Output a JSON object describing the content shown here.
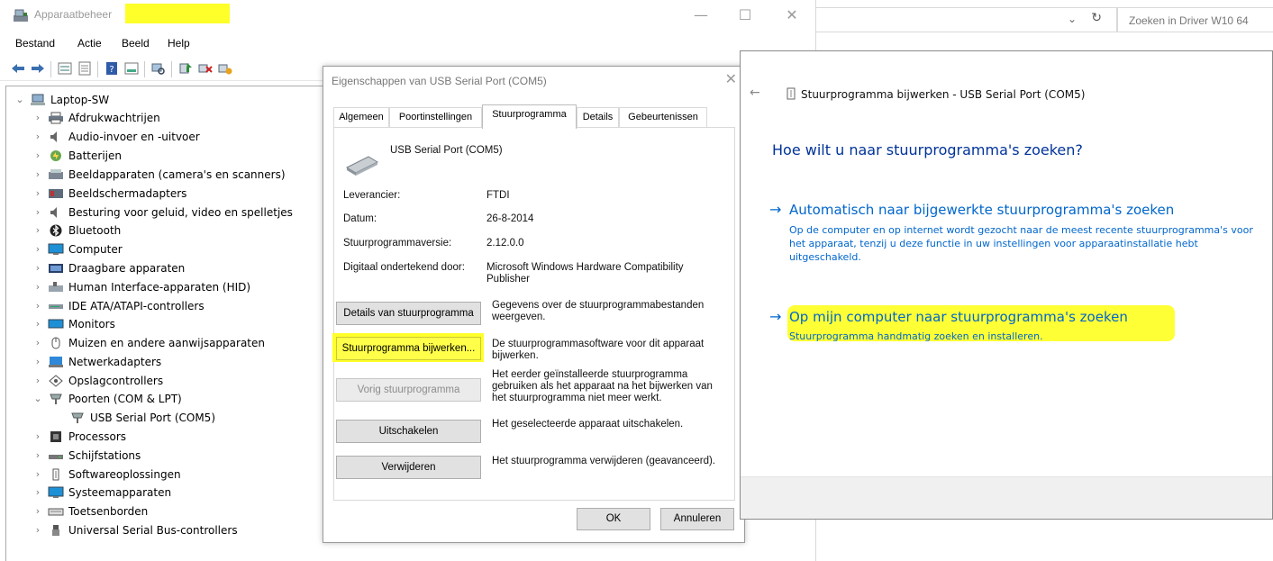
{
  "devmgr": {
    "title": "Apparaatbeheer",
    "window_buttons": {
      "minimize": "—",
      "maximize": "☐",
      "close": "✕"
    },
    "menu": [
      "Bestand",
      "Actie",
      "Beeld",
      "Help"
    ],
    "tree": {
      "root": "Laptop-SW",
      "items": [
        "Afdrukwachtrijen",
        "Audio-invoer en -uitvoer",
        "Batterijen",
        "Beeldapparaten (camera's en scanners)",
        "Beeldschermadapters",
        "Besturing voor geluid, video en spelletjes",
        "Bluetooth",
        "Computer",
        "Draagbare apparaten",
        "Human Interface-apparaten (HID)",
        "IDE ATA/ATAPI-controllers",
        "Monitors",
        "Muizen en andere aanwijsapparaten",
        "Netwerkadapters",
        "Opslagcontrollers",
        "Poorten (COM & LPT)",
        "USB Serial Port (COM5)",
        "Processors",
        "Schijfstations",
        "Softwareoplossingen",
        "Systeemapparaten",
        "Toetsenborden",
        "Universal Serial Bus-controllers"
      ]
    }
  },
  "props": {
    "title": "Eigenschappen van USB Serial Port (COM5)",
    "close": "✕",
    "tabs": [
      "Algemeen",
      "Poortinstellingen",
      "Stuurprogramma",
      "Details",
      "Gebeurtenissen"
    ],
    "device_name": "USB Serial Port (COM5)",
    "fields": {
      "provider_label": "Leverancier:",
      "provider_value": "FTDI",
      "date_label": "Datum:",
      "date_value": "26-8-2014",
      "version_label": "Stuurprogrammaversie:",
      "version_value": "2.12.0.0",
      "signer_label": "Digitaal ondertekend door:",
      "signer_value": "Microsoft Windows Hardware Compatibility Publisher"
    },
    "actions": {
      "details_btn": "Details van stuurprogramma",
      "details_desc": "Gegevens over de stuurprogrammabestanden weergeven.",
      "update_btn": "Stuurprogramma bijwerken...",
      "update_desc": "De stuurprogrammasoftware voor dit apparaat bijwerken.",
      "rollback_btn": "Vorig stuurprogramma",
      "rollback_desc": "Het eerder geïnstalleerde stuurprogramma gebruiken als het apparaat na het bijwerken van het stuurprogramma niet meer werkt.",
      "disable_btn": "Uitschakelen",
      "disable_desc": "Het geselecteerde apparaat uitschakelen.",
      "uninstall_btn": "Verwijderen",
      "uninstall_desc": "Het stuurprogramma verwijderen (geavanceerd)."
    },
    "ok": "OK",
    "cancel": "Annuleren"
  },
  "explorer": {
    "search_placeholder": "Zoeken in Driver W10 64"
  },
  "wizard": {
    "back": "←",
    "title": "Stuurprogramma bijwerken - USB Serial Port (COM5)",
    "heading": "Hoe wilt u naar stuurprogramma's zoeken?",
    "option_auto_title": "Automatisch naar bijgewerkte stuurprogramma's zoeken",
    "option_auto_desc": "Op de computer en op internet wordt gezocht naar de meest recente stuurprogramma's voor het apparaat, tenzij u deze functie in uw instellingen voor apparaatinstallatie hebt uitgeschakeld.",
    "option_manual_title": "Op mijn computer naar stuurprogramma's zoeken",
    "option_manual_desc": "Stuurprogramma handmatig zoeken en installeren.",
    "arrow": "→"
  },
  "colors": {
    "highlight": "#ffff2a",
    "link_blue": "#0066cc",
    "heading_blue": "#003399"
  }
}
